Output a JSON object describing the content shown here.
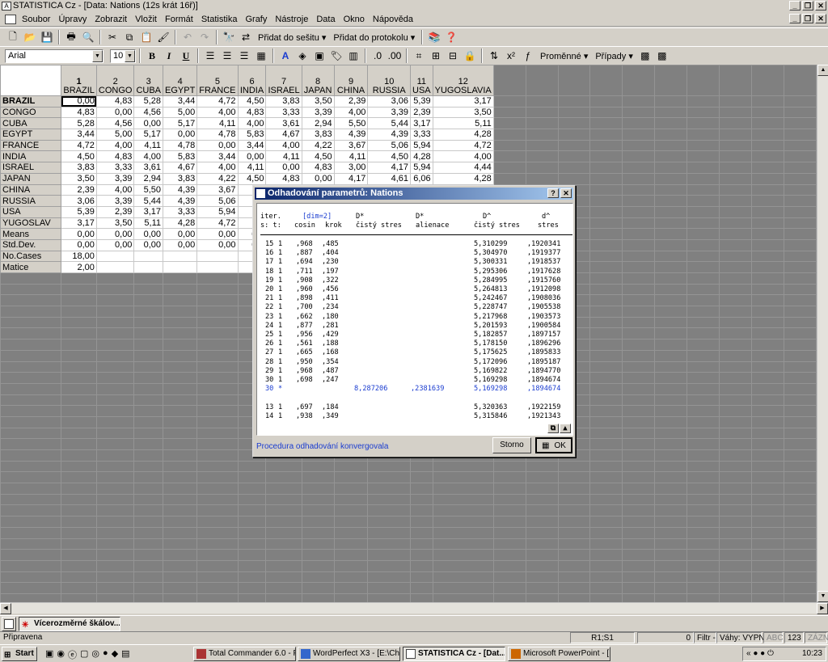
{
  "app": {
    "title": "STATISTICA Cz - [Data: Nations (12s krát 16ř)]",
    "menu": [
      "Soubor",
      "Úpravy",
      "Zobrazit",
      "Vložit",
      "Formát",
      "Statistika",
      "Grafy",
      "Nástroje",
      "Data",
      "Okno",
      "Nápověda"
    ],
    "toolbar1": {
      "add_to_workbook": "Přidat do sešitu",
      "add_to_protocol": "Přidat do protokolu"
    },
    "toolbar2": {
      "font": "Arial",
      "size": "10",
      "bold": "B",
      "italic": "I",
      "underline": "U",
      "variables": "Proměnné",
      "cases": "Případy"
    }
  },
  "sheet": {
    "col_numbers": [
      "1",
      "2",
      "3",
      "4",
      "5",
      "6",
      "7",
      "8",
      "9",
      "10",
      "11",
      "12"
    ],
    "col_names": [
      "BRAZIL",
      "CONGO",
      "CUBA",
      "EGYPT",
      "FRANCE",
      "INDIA",
      "ISRAEL",
      "JAPAN",
      "CHINA",
      "RUSSIA",
      "USA",
      "YUGOSLAVIA"
    ],
    "rows": [
      {
        "name": "BRAZIL",
        "values": [
          "0,00",
          "4,83",
          "5,28",
          "3,44",
          "4,72",
          "4,50",
          "3,83",
          "3,50",
          "2,39",
          "3,06",
          "5,39",
          "3,17"
        ]
      },
      {
        "name": "CONGO",
        "values": [
          "4,83",
          "0,00",
          "4,56",
          "5,00",
          "4,00",
          "4,83",
          "3,33",
          "3,39",
          "4,00",
          "3,39",
          "2,39",
          "3,50"
        ]
      },
      {
        "name": "CUBA",
        "values": [
          "5,28",
          "4,56",
          "0,00",
          "5,17",
          "4,11",
          "4,00",
          "3,61",
          "2,94",
          "5,50",
          "5,44",
          "3,17",
          "5,11"
        ]
      },
      {
        "name": "EGYPT",
        "values": [
          "3,44",
          "5,00",
          "5,17",
          "0,00",
          "4,78",
          "5,83",
          "4,67",
          "3,83",
          "4,39",
          "4,39",
          "3,33",
          "4,28"
        ]
      },
      {
        "name": "FRANCE",
        "values": [
          "4,72",
          "4,00",
          "4,11",
          "4,78",
          "0,00",
          "3,44",
          "4,00",
          "4,22",
          "3,67",
          "5,06",
          "5,94",
          "4,72"
        ]
      },
      {
        "name": "INDIA",
        "values": [
          "4,50",
          "4,83",
          "4,00",
          "5,83",
          "3,44",
          "0,00",
          "4,11",
          "4,50",
          "4,11",
          "4,50",
          "4,28",
          "4,00"
        ]
      },
      {
        "name": "ISRAEL",
        "values": [
          "3,83",
          "3,33",
          "3,61",
          "4,67",
          "4,00",
          "4,11",
          "0,00",
          "4,83",
          "3,00",
          "4,17",
          "5,94",
          "4,44"
        ]
      },
      {
        "name": "JAPAN",
        "values": [
          "3,50",
          "3,39",
          "2,94",
          "3,83",
          "4,22",
          "4,50",
          "4,83",
          "0,00",
          "4,17",
          "4,61",
          "6,06",
          "4,28"
        ]
      },
      {
        "name": "CHINA",
        "values": [
          "2,39",
          "4,00",
          "5,50",
          "4,39",
          "3,67",
          "4,",
          "",
          "",
          "",
          "",
          "",
          ""
        ]
      },
      {
        "name": "RUSSIA",
        "values": [
          "3,06",
          "3,39",
          "5,44",
          "4,39",
          "5,06",
          "4,",
          "",
          "",
          "",
          "",
          "",
          ""
        ]
      },
      {
        "name": "USA",
        "values": [
          "5,39",
          "2,39",
          "3,17",
          "3,33",
          "5,94",
          "4,",
          "",
          "",
          "",
          "",
          "",
          ""
        ]
      },
      {
        "name": "YUGOSLAV",
        "values": [
          "3,17",
          "3,50",
          "5,11",
          "4,28",
          "4,72",
          "4,",
          "",
          "",
          "",
          "",
          "",
          ""
        ]
      },
      {
        "name": "Means",
        "values": [
          "0,00",
          "0,00",
          "0,00",
          "0,00",
          "0,00",
          "0,0",
          "",
          "",
          "",
          "",
          "",
          ""
        ]
      },
      {
        "name": "Std.Dev.",
        "values": [
          "0,00",
          "0,00",
          "0,00",
          "0,00",
          "0,00",
          "0,0",
          "",
          "",
          "",
          "",
          "",
          ""
        ]
      },
      {
        "name": "No.Cases",
        "values": [
          "18,00",
          "",
          "",
          "",
          "",
          "",
          "",
          "",
          "",
          "",
          "",
          ""
        ]
      },
      {
        "name": "Matice",
        "values": [
          "2,00",
          "",
          "",
          "",
          "",
          "",
          "",
          "",
          "",
          "",
          "",
          ""
        ]
      }
    ]
  },
  "dialog": {
    "title": "Odhadování parametrů: Nations",
    "header1": {
      "iter": "iter.",
      "dim": "[dim=2]",
      "d1": "D*",
      "d2": "D*",
      "d3": "D^",
      "d4": "d^"
    },
    "header2": {
      "st": "s: t:",
      "cosin": "cosin",
      "krok": "krok",
      "cs1": "čistý stres",
      "alien": "alienace",
      "cs2": "čistý stres",
      "stres": "stres"
    },
    "iterations": [
      {
        "it": "15",
        "t": "1",
        "cosin": ",968",
        "krok": ",485",
        "d": "",
        "a": "",
        "cs": "5,310299",
        "s": ",1920341"
      },
      {
        "it": "16",
        "t": "1",
        "cosin": ",887",
        "krok": ",404",
        "d": "",
        "a": "",
        "cs": "5,304970",
        "s": ",1919377"
      },
      {
        "it": "17",
        "t": "1",
        "cosin": ",694",
        "krok": ",230",
        "d": "",
        "a": "",
        "cs": "5,300331",
        "s": ",1918537"
      },
      {
        "it": "18",
        "t": "1",
        "cosin": ",711",
        "krok": ",197",
        "d": "",
        "a": "",
        "cs": "5,295306",
        "s": ",1917628"
      },
      {
        "it": "19",
        "t": "1",
        "cosin": ",908",
        "krok": ",322",
        "d": "",
        "a": "",
        "cs": "5,284995",
        "s": ",1915760"
      },
      {
        "it": "20",
        "t": "1",
        "cosin": ",960",
        "krok": ",456",
        "d": "",
        "a": "",
        "cs": "5,264813",
        "s": ",1912098"
      },
      {
        "it": "21",
        "t": "1",
        "cosin": ",898",
        "krok": ",411",
        "d": "",
        "a": "",
        "cs": "5,242467",
        "s": ",1908036"
      },
      {
        "it": "22",
        "t": "1",
        "cosin": ",700",
        "krok": ",234",
        "d": "",
        "a": "",
        "cs": "5,228747",
        "s": ",1905538"
      },
      {
        "it": "23",
        "t": "1",
        "cosin": ",662",
        "krok": ",180",
        "d": "",
        "a": "",
        "cs": "5,217968",
        "s": ",1903573"
      },
      {
        "it": "24",
        "t": "1",
        "cosin": ",877",
        "krok": ",281",
        "d": "",
        "a": "",
        "cs": "5,201593",
        "s": ",1900584"
      },
      {
        "it": "25",
        "t": "1",
        "cosin": ",956",
        "krok": ",429",
        "d": "",
        "a": "",
        "cs": "5,182857",
        "s": ",1897157"
      },
      {
        "it": "26",
        "t": "1",
        "cosin": ",561",
        "krok": ",188",
        "d": "",
        "a": "",
        "cs": "5,178150",
        "s": ",1896296"
      },
      {
        "it": "27",
        "t": "1",
        "cosin": ",665",
        "krok": ",168",
        "d": "",
        "a": "",
        "cs": "5,175625",
        "s": ",1895833"
      },
      {
        "it": "28",
        "t": "1",
        "cosin": ",950",
        "krok": ",354",
        "d": "",
        "a": "",
        "cs": "5,172096",
        "s": ",1895187"
      },
      {
        "it": "29",
        "t": "1",
        "cosin": ",968",
        "krok": ",487",
        "d": "",
        "a": "",
        "cs": "5,169822",
        "s": ",1894770"
      },
      {
        "it": "30",
        "t": "1",
        "cosin": ",698",
        "krok": ",247",
        "d": "",
        "a": "",
        "cs": "5,169298",
        "s": ",1894674"
      },
      {
        "it": "30",
        "t": "*",
        "cosin": "",
        "krok": "",
        "d": "8,287206",
        "a": ",2381639",
        "cs": "5,169298",
        "s": ",1894674",
        "highlight": true
      },
      {
        "it": "",
        "t": "",
        "cosin": "",
        "krok": "",
        "d": "",
        "a": "",
        "cs": "",
        "s": ""
      },
      {
        "it": "13",
        "t": "1",
        "cosin": ",697",
        "krok": ",184",
        "d": "",
        "a": "",
        "cs": "5,320363",
        "s": ",1922159"
      },
      {
        "it": "14",
        "t": "1",
        "cosin": ",938",
        "krok": ",349",
        "d": "",
        "a": "",
        "cs": "5,315846",
        "s": ",1921343"
      }
    ],
    "status": "Procedura odhadování konvergovala",
    "cancel": "Storno",
    "ok": "OK"
  },
  "app_taskbar": {
    "item": "Vícerozměrné škálov..."
  },
  "statusbar": {
    "ready": "Připravena",
    "cell": "R1;S1",
    "zero": "0",
    "filter": "Filtr -",
    "weights": "Váhy: VYPN",
    "abc": "ABC",
    "num": "123",
    "zaznam": "ZÁZN"
  },
  "taskbar": {
    "start": "Start",
    "tasks": [
      "Total Commander 6.0 - P...",
      "WordPerfect X3 - [E:\\Ch...",
      "STATISTICA Cz - [Dat...",
      "Microsoft PowerPoint - [..."
    ],
    "clock": "10:23"
  }
}
